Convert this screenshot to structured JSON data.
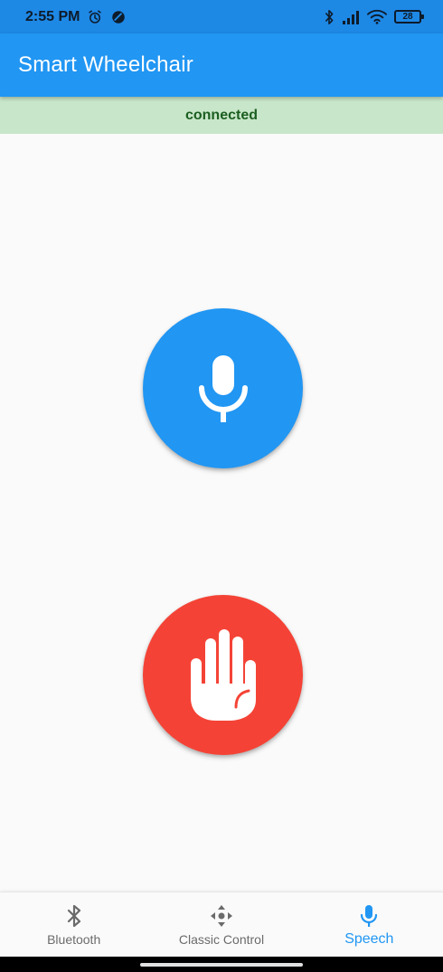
{
  "status_bar": {
    "time": "2:55 PM",
    "left_icons": [
      "alarm-icon",
      "do-not-disturb-icon"
    ],
    "right_icons": [
      "bluetooth-icon",
      "signal-icon",
      "wifi-icon"
    ],
    "battery": "28"
  },
  "app_bar": {
    "title": "Smart Wheelchair"
  },
  "connection": {
    "status": "connected"
  },
  "actions": {
    "mic": {
      "icon": "microphone-icon",
      "color": "#2196f3"
    },
    "stop": {
      "icon": "stop-hand-icon",
      "color": "#f44336"
    }
  },
  "bottom_nav": {
    "items": [
      {
        "label": "Bluetooth",
        "icon": "bluetooth-icon",
        "active": false
      },
      {
        "label": "Classic Control",
        "icon": "gamepad-icon",
        "active": false
      },
      {
        "label": "Speech",
        "icon": "microphone-icon",
        "active": true
      }
    ]
  },
  "colors": {
    "primary": "#2196f3",
    "status_bar": "#1e88e5",
    "connected_bg": "#c8e6c9",
    "connected_text": "#1b5e20",
    "stop": "#f44336",
    "inactive": "#6b6b6b"
  }
}
